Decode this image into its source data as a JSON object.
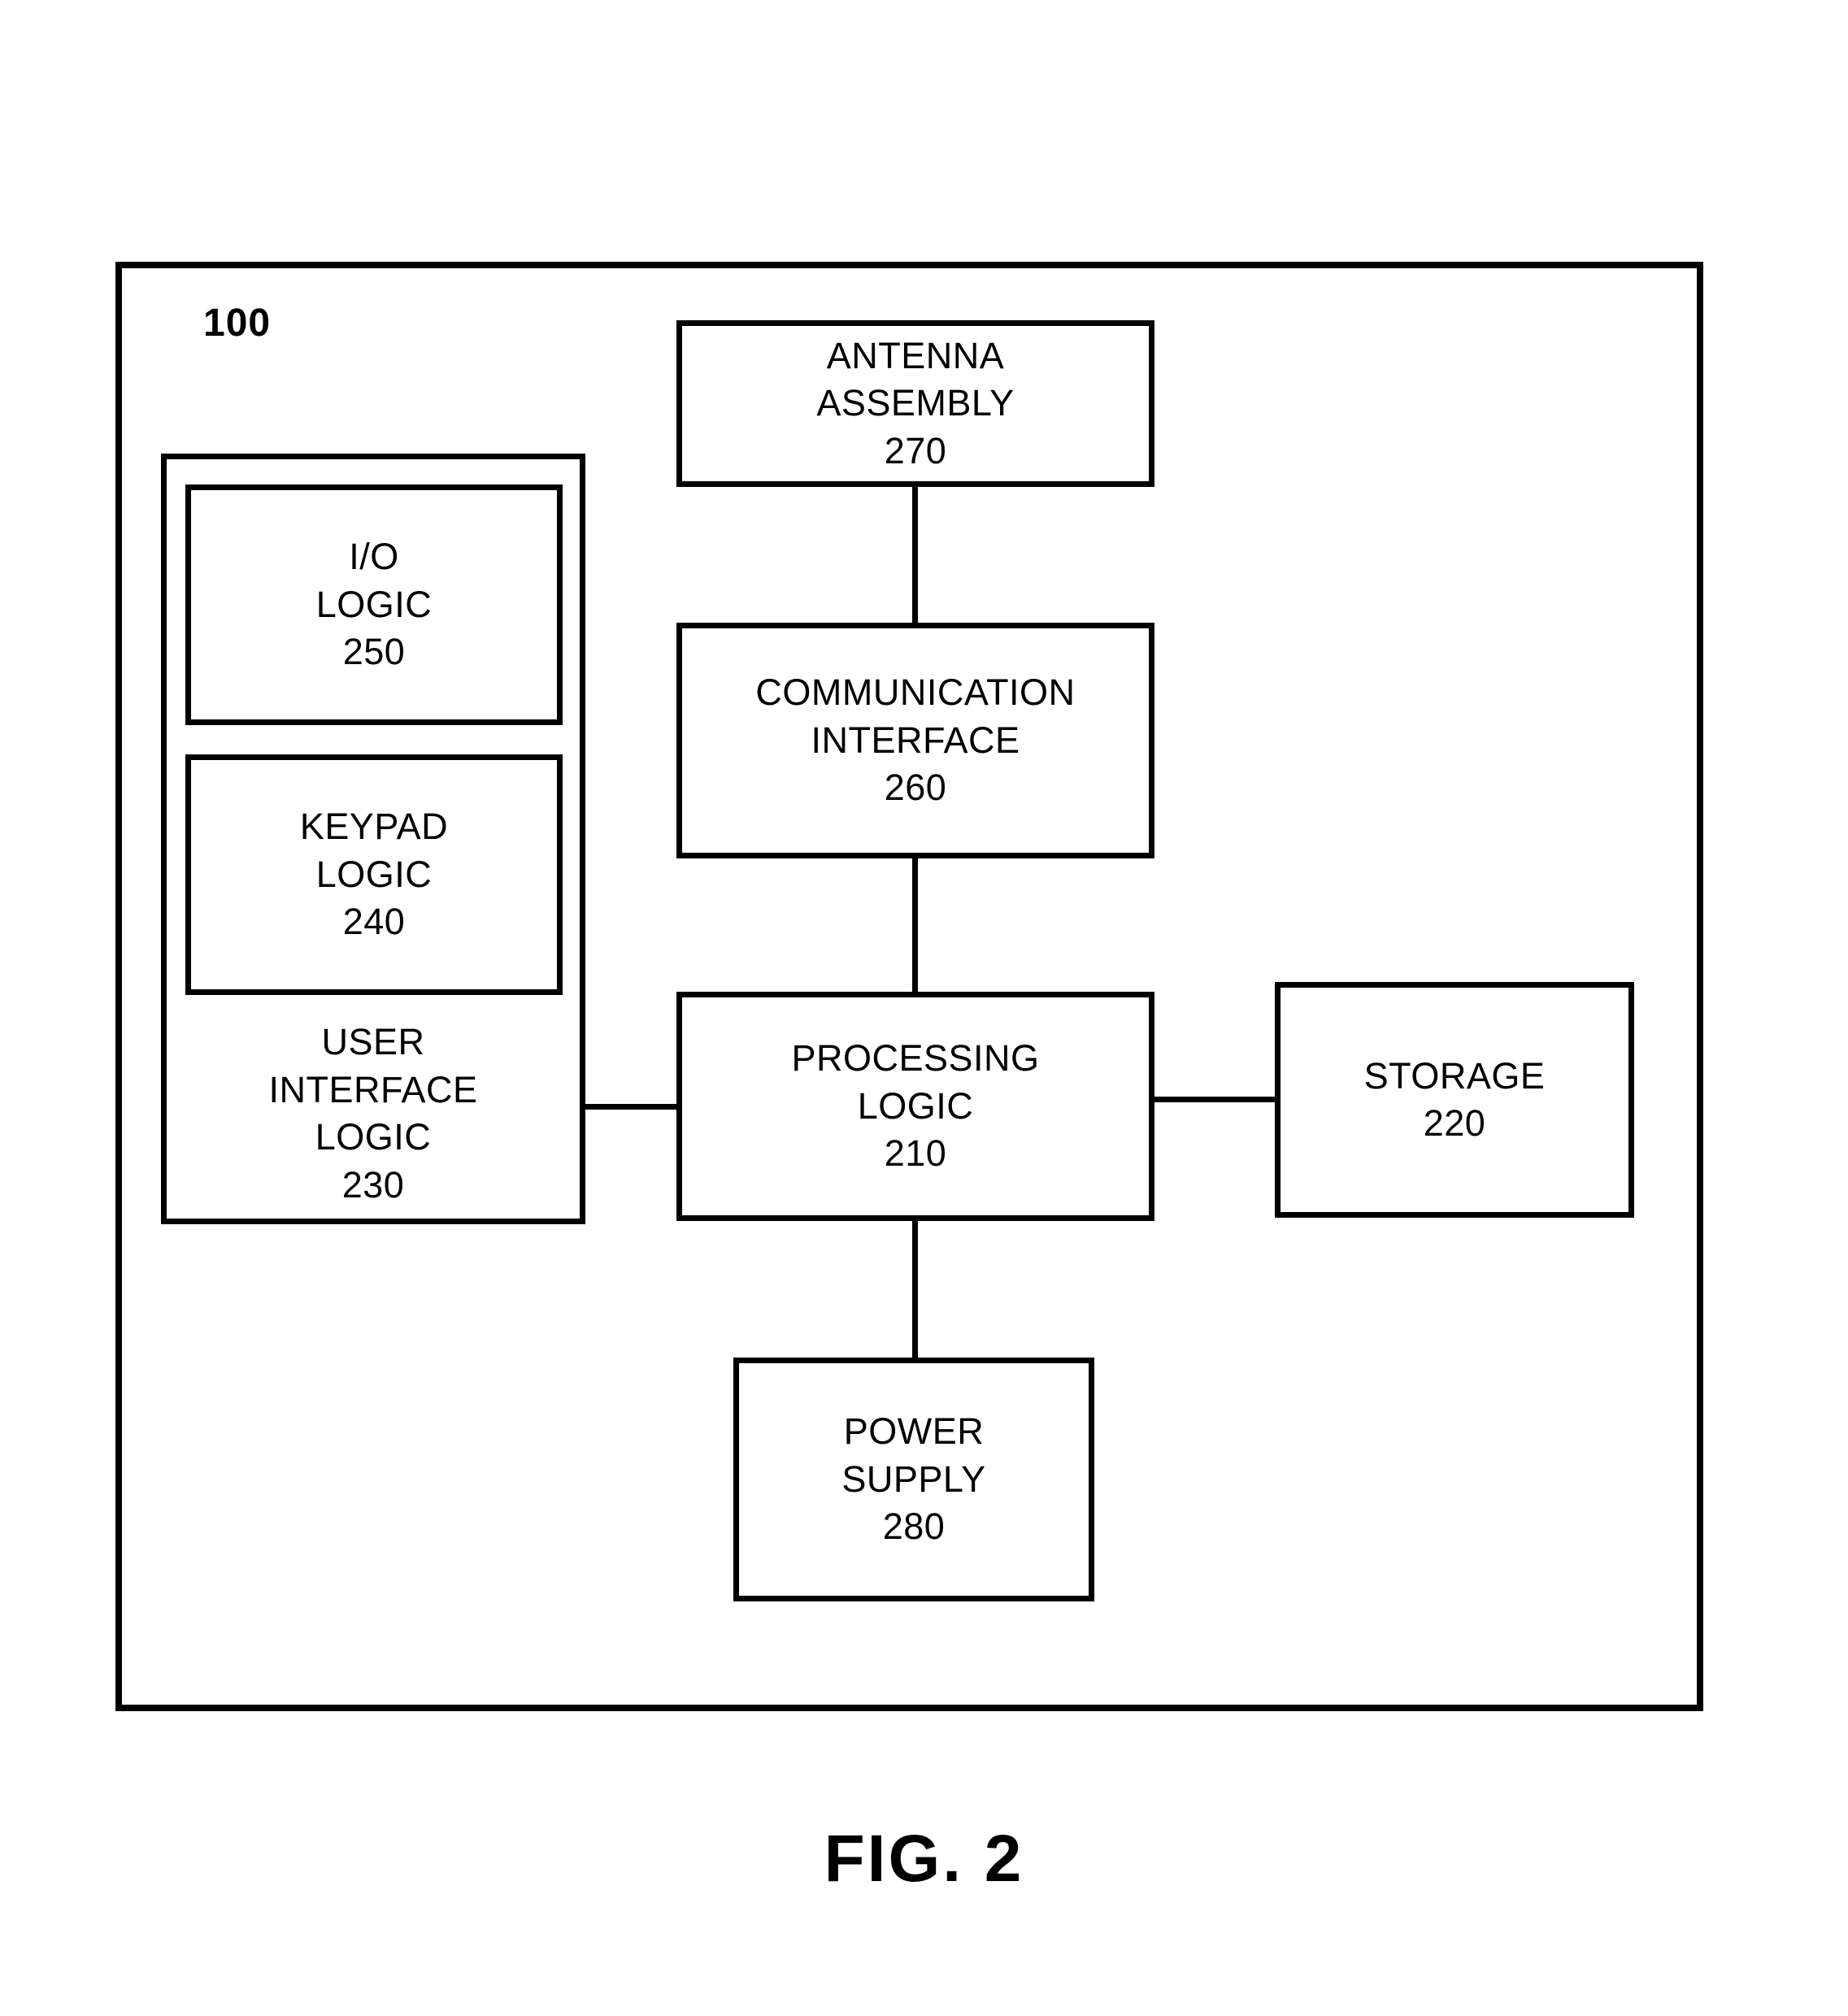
{
  "figure": {
    "caption": "FIG. 2",
    "device_reference": "100"
  },
  "blocks": {
    "antenna_assembly": {
      "line1": "ANTENNA",
      "line2": "ASSEMBLY",
      "ref": "270"
    },
    "communication_interface": {
      "line1": "COMMUNICATION",
      "line2": "INTERFACE",
      "ref": "260"
    },
    "processing_logic": {
      "line1": "PROCESSING",
      "line2": "LOGIC",
      "ref": "210"
    },
    "storage": {
      "line1": "STORAGE",
      "ref": "220"
    },
    "power_supply": {
      "line1": "POWER",
      "line2": "SUPPLY",
      "ref": "280"
    },
    "user_interface_logic": {
      "line1": "USER",
      "line2": "INTERFACE",
      "line3": "LOGIC",
      "ref": "230"
    },
    "io_logic": {
      "line1": "I/O",
      "line2": "LOGIC",
      "ref": "250"
    },
    "keypad_logic": {
      "line1": "KEYPAD",
      "line2": "LOGIC",
      "ref": "240"
    }
  },
  "colors": {
    "stroke": "#000000",
    "background": "#ffffff"
  }
}
